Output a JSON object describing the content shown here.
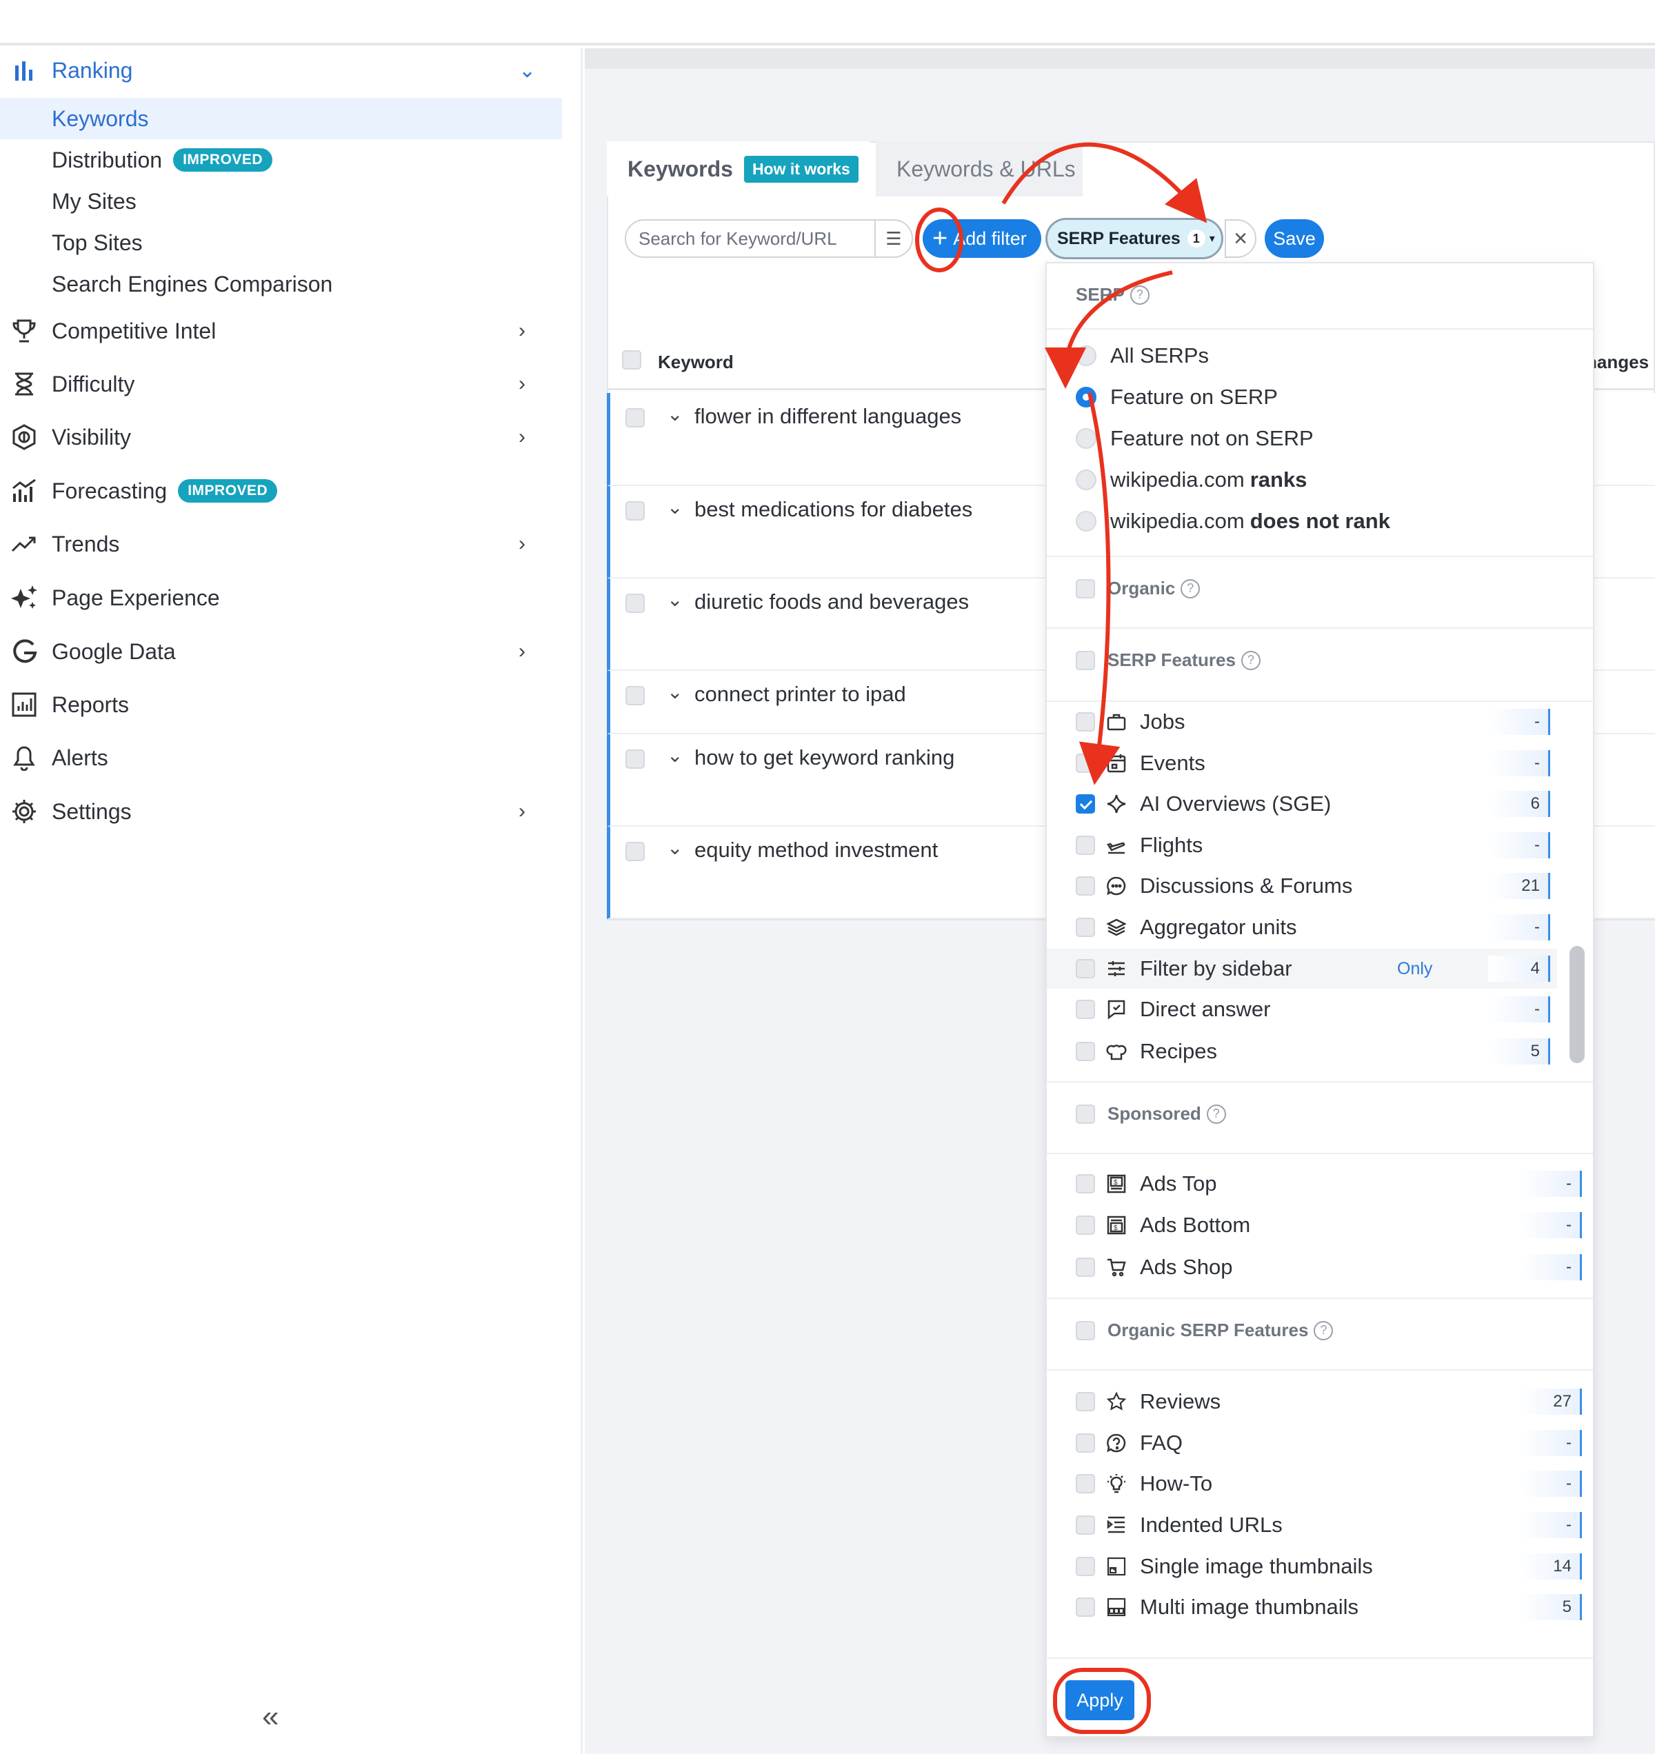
{
  "sidebar": {
    "section": {
      "label": "Ranking"
    },
    "sub_items": [
      {
        "label": "Keywords"
      },
      {
        "label": "Distribution",
        "badge": "IMPROVED"
      },
      {
        "label": "My Sites"
      },
      {
        "label": "Top Sites"
      },
      {
        "label": "Search Engines Comparison"
      }
    ],
    "items": [
      {
        "label": "Competitive Intel",
        "icon": "trophy-icon"
      },
      {
        "label": "Difficulty",
        "icon": "hourglass-icon"
      },
      {
        "label": "Visibility",
        "icon": "visibility-icon"
      },
      {
        "label": "Forecasting",
        "icon": "forecast-icon",
        "badge": "IMPROVED"
      },
      {
        "label": "Trends",
        "icon": "trend-icon"
      },
      {
        "label": "Page Experience",
        "icon": "sparkle-icon"
      },
      {
        "label": "Google Data",
        "icon": "google-icon"
      },
      {
        "label": "Reports",
        "icon": "report-icon"
      },
      {
        "label": "Alerts",
        "icon": "bell-icon"
      },
      {
        "label": "Settings",
        "icon": "gear-icon"
      }
    ],
    "collapse_glyph": "«"
  },
  "tabs": {
    "active": {
      "label": "Keywords",
      "badge": "How it works"
    },
    "other": {
      "label": "Keywords & URLs"
    }
  },
  "toolbar": {
    "search_placeholder": "Search for Keyword/URL",
    "add_filter": "Add filter",
    "chip_label": "SERP Features",
    "chip_count": "1",
    "save": "Save"
  },
  "table": {
    "col_keyword": "Keyword",
    "col_changes": "hanges",
    "rows": [
      {
        "keyword": "flower in different languages"
      },
      {
        "keyword": "best medications for diabetes"
      },
      {
        "keyword": "diuretic foods and beverages"
      },
      {
        "keyword": "connect printer to ipad"
      },
      {
        "keyword": "how to get keyword ranking"
      },
      {
        "keyword": "equity method investment"
      }
    ]
  },
  "dropdown": {
    "serp_title": "SERP",
    "serp_options": [
      {
        "label": "All SERPs",
        "selected": false
      },
      {
        "label": "Feature on SERP",
        "selected": true
      },
      {
        "label": "Feature not on SERP",
        "selected": false
      },
      {
        "prefix": "wikipedia.com",
        "bold": "ranks",
        "selected": false
      },
      {
        "prefix": "wikipedia.com",
        "bold": "does not rank",
        "selected": false
      }
    ],
    "organic_title": "Organic",
    "serp_features_title": "SERP Features",
    "serp_features": [
      {
        "label": "Jobs",
        "icon": "briefcase-icon",
        "count": "-",
        "checked": false
      },
      {
        "label": "Events",
        "icon": "calendar-icon",
        "count": "-",
        "checked": false
      },
      {
        "label": "AI Overviews (SGE)",
        "icon": "diamond-sparkle-icon",
        "count": "6",
        "checked": true
      },
      {
        "label": "Flights",
        "icon": "plane-icon",
        "count": "-",
        "checked": false
      },
      {
        "label": "Discussions & Forums",
        "icon": "chat-bubble-icon",
        "count": "21",
        "checked": false
      },
      {
        "label": "Aggregator units",
        "icon": "layers-icon",
        "count": "-",
        "checked": false
      },
      {
        "label": "Filter by sidebar",
        "icon": "sliders-icon",
        "count": "4",
        "checked": false,
        "only": "Only"
      },
      {
        "label": "Direct answer",
        "icon": "answer-icon",
        "count": "-",
        "checked": false
      },
      {
        "label": "Recipes",
        "icon": "chef-hat-icon",
        "count": "5",
        "checked": false
      }
    ],
    "sponsored_title": "Sponsored",
    "sponsored": [
      {
        "label": "Ads Top",
        "icon": "ads-top-icon",
        "count": "-",
        "checked": false
      },
      {
        "label": "Ads Bottom",
        "icon": "ads-bottom-icon",
        "count": "-",
        "checked": false
      },
      {
        "label": "Ads Shop",
        "icon": "cart-icon",
        "count": "-",
        "checked": false
      }
    ],
    "organic_features_title": "Organic SERP Features",
    "organic_features": [
      {
        "label": "Reviews",
        "icon": "star-icon",
        "count": "27",
        "checked": false
      },
      {
        "label": "FAQ",
        "icon": "question-icon",
        "count": "-",
        "checked": false
      },
      {
        "label": "How-To",
        "icon": "lightbulb-icon",
        "count": "-",
        "checked": false
      },
      {
        "label": "Indented URLs",
        "icon": "indent-icon",
        "count": "-",
        "checked": false
      },
      {
        "label": "Single image thumbnails",
        "icon": "image-icon",
        "count": "14",
        "checked": false
      },
      {
        "label": "Multi image thumbnails",
        "icon": "images-icon",
        "count": "5",
        "checked": false
      }
    ],
    "apply": "Apply"
  },
  "colors": {
    "primary": "#1a7fe4",
    "badge": "#16a3bd",
    "annotation": "#e8321e",
    "link": "#2c6fd1"
  }
}
